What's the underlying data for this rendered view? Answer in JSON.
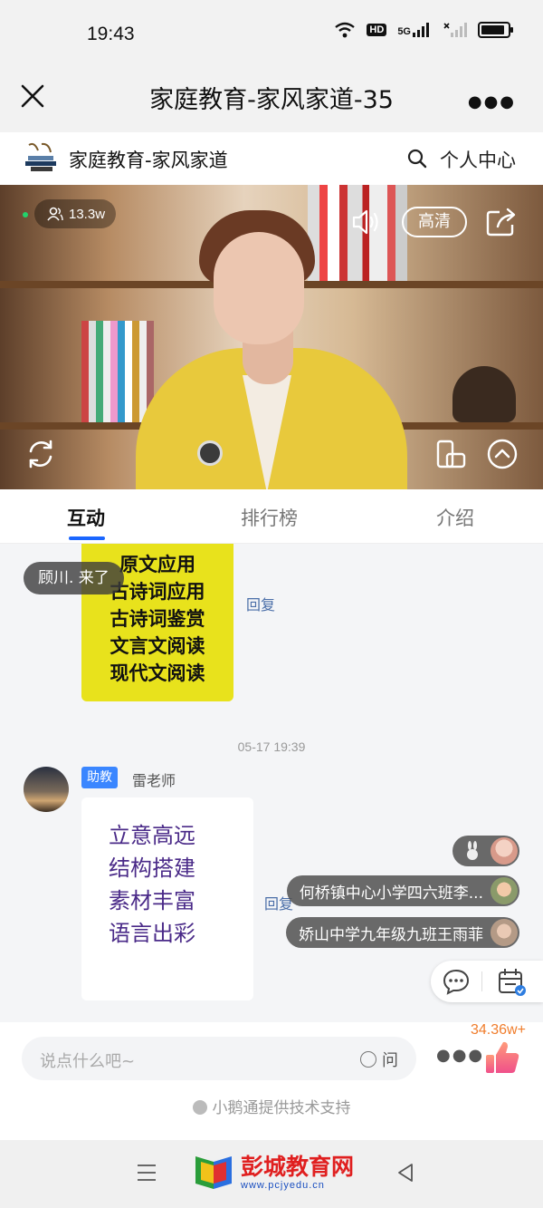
{
  "status_bar": {
    "time": "19:43",
    "hd": "HD",
    "network": "5G",
    "battery_level": 0.9
  },
  "nav": {
    "title": "家庭教育-家风家道-35"
  },
  "sub_header": {
    "channel_name": "家庭教育-家风家道",
    "personal_center": "个人中心"
  },
  "video": {
    "viewer_count": "13.3w",
    "quality_label": "高清"
  },
  "tabs": [
    {
      "label": "互动",
      "active": true
    },
    {
      "label": "排行榜",
      "active": false
    },
    {
      "label": "介绍",
      "active": false
    }
  ],
  "chat": {
    "poster_lines": [
      "原文应用",
      "古诗词应用",
      "古诗词鉴赏",
      "文言文阅读",
      "现代文阅读"
    ],
    "reply_label": "回复",
    "join_toast": "顾川. 来了",
    "timestamp": "05-17 19:39",
    "message": {
      "role_badge": "助教",
      "sender": "雷老师",
      "card_lines": [
        "立意高远",
        "结构搭建",
        "素材丰富",
        "语言出彩"
      ]
    },
    "gift_rows": [
      {
        "text": ""
      },
      {
        "text": "何桥镇中心小学四六班李..."
      },
      {
        "text": "娇山中学九年级九班王雨菲"
      }
    ]
  },
  "input_bar": {
    "placeholder": "说点什么吧~",
    "ask_label": "问",
    "like_count": "34.36w+",
    "powered_by": "小鹅通提供技术支持"
  },
  "watermark": {
    "name": "彭城教育网",
    "url": "www.pcjyedu.cn"
  },
  "colors": {
    "accent": "#1a66ff",
    "badge": "#3a86ff",
    "like": "#f07d2c"
  }
}
